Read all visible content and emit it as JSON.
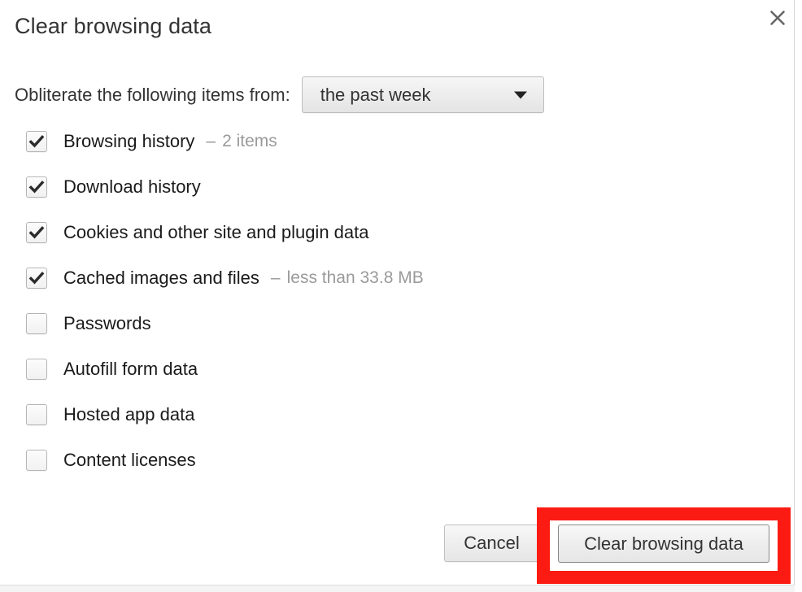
{
  "dialog": {
    "title": "Clear browsing data",
    "close_icon": "close-icon",
    "close_label": "×"
  },
  "time_range": {
    "label": "Obliterate the following items from:",
    "selected": "the past week",
    "arrow_icon": "chevron-down-icon"
  },
  "items": [
    {
      "label": "Browsing history",
      "checked": true,
      "dash": "–",
      "meta": "2 items"
    },
    {
      "label": "Download history",
      "checked": true,
      "dash": "",
      "meta": ""
    },
    {
      "label": "Cookies and other site and plugin data",
      "checked": true,
      "dash": "",
      "meta": ""
    },
    {
      "label": "Cached images and files",
      "checked": true,
      "dash": "–",
      "meta": "less than 33.8 MB"
    },
    {
      "label": "Passwords",
      "checked": false,
      "dash": "",
      "meta": ""
    },
    {
      "label": "Autofill form data",
      "checked": false,
      "dash": "",
      "meta": ""
    },
    {
      "label": "Hosted app data",
      "checked": false,
      "dash": "",
      "meta": ""
    },
    {
      "label": "Content licenses",
      "checked": false,
      "dash": "",
      "meta": ""
    }
  ],
  "footer": {
    "cancel_label": "Cancel",
    "confirm_label": "Clear browsing data"
  },
  "annotation": {
    "highlight_color": "#fb1b13",
    "target": "confirm-button"
  }
}
